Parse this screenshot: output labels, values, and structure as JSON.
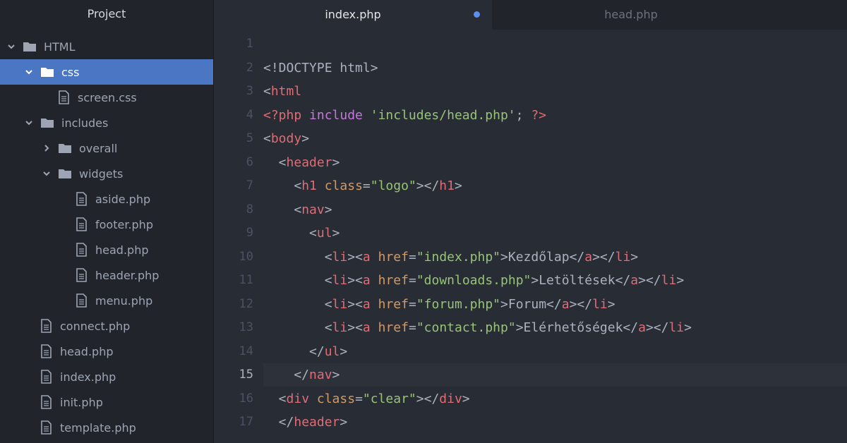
{
  "sidebar": {
    "title": "Project",
    "items": [
      {
        "label": "HTML",
        "type": "folder",
        "depth": 0,
        "expanded": true
      },
      {
        "label": "css",
        "type": "folder",
        "depth": 1,
        "expanded": true,
        "selected": true
      },
      {
        "label": "screen.css",
        "type": "file",
        "depth": 2
      },
      {
        "label": "includes",
        "type": "folder",
        "depth": 1,
        "expanded": true
      },
      {
        "label": "overall",
        "type": "folder",
        "depth": 2,
        "expanded": false
      },
      {
        "label": "widgets",
        "type": "folder",
        "depth": 2,
        "expanded": true
      },
      {
        "label": "aside.php",
        "type": "file",
        "depth": 3
      },
      {
        "label": "footer.php",
        "type": "file",
        "depth": 3
      },
      {
        "label": "head.php",
        "type": "file",
        "depth": 3
      },
      {
        "label": "header.php",
        "type": "file",
        "depth": 3
      },
      {
        "label": "menu.php",
        "type": "file",
        "depth": 3
      },
      {
        "label": "connect.php",
        "type": "file",
        "depth": 1
      },
      {
        "label": "head.php",
        "type": "file",
        "depth": 1
      },
      {
        "label": "index.php",
        "type": "file",
        "depth": 1
      },
      {
        "label": "init.php",
        "type": "file",
        "depth": 1
      },
      {
        "label": "template.php",
        "type": "file",
        "depth": 1
      }
    ]
  },
  "tabs": [
    {
      "label": "index.php",
      "active": true,
      "modified": true
    },
    {
      "label": "head.php",
      "active": false
    }
  ],
  "editor": {
    "active_line": 15,
    "lines": [
      {
        "n": "1",
        "tokens": []
      },
      {
        "n": "2",
        "tokens": [
          [
            "p",
            "<!DOCTYPE html>"
          ]
        ]
      },
      {
        "n": "3",
        "tokens": [
          [
            "p",
            "<"
          ],
          [
            "t",
            "html"
          ]
        ]
      },
      {
        "n": "4",
        "tokens": [
          [
            "t",
            "<?php"
          ],
          [
            "p",
            " "
          ],
          [
            "k",
            "include"
          ],
          [
            "p",
            " "
          ],
          [
            "s",
            "'includes/head.php'"
          ],
          [
            "p",
            "; "
          ],
          [
            "t",
            "?>"
          ]
        ]
      },
      {
        "n": "5",
        "tokens": [
          [
            "p",
            "<"
          ],
          [
            "t",
            "body"
          ],
          [
            "p",
            ">"
          ]
        ]
      },
      {
        "n": "6",
        "tokens": [
          [
            "p",
            "  <"
          ],
          [
            "t",
            "header"
          ],
          [
            "p",
            ">"
          ]
        ]
      },
      {
        "n": "7",
        "tokens": [
          [
            "p",
            "    <"
          ],
          [
            "t",
            "h1"
          ],
          [
            "p",
            " "
          ],
          [
            "a",
            "class"
          ],
          [
            "p",
            "="
          ],
          [
            "s",
            "\"logo\""
          ],
          [
            "p",
            "></"
          ],
          [
            "t",
            "h1"
          ],
          [
            "p",
            ">"
          ]
        ]
      },
      {
        "n": "8",
        "tokens": [
          [
            "p",
            "    <"
          ],
          [
            "t",
            "nav"
          ],
          [
            "p",
            ">"
          ]
        ]
      },
      {
        "n": "9",
        "tokens": [
          [
            "p",
            "      <"
          ],
          [
            "t",
            "ul"
          ],
          [
            "p",
            ">"
          ]
        ]
      },
      {
        "n": "10",
        "tokens": [
          [
            "p",
            "        <"
          ],
          [
            "t",
            "li"
          ],
          [
            "p",
            "><"
          ],
          [
            "t",
            "a"
          ],
          [
            "p",
            " "
          ],
          [
            "a",
            "href"
          ],
          [
            "p",
            "="
          ],
          [
            "s",
            "\"index.php\""
          ],
          [
            "p",
            ">Kezdőlap</"
          ],
          [
            "t",
            "a"
          ],
          [
            "p",
            "></"
          ],
          [
            "t",
            "li"
          ],
          [
            "p",
            ">"
          ]
        ]
      },
      {
        "n": "11",
        "tokens": [
          [
            "p",
            "        <"
          ],
          [
            "t",
            "li"
          ],
          [
            "p",
            "><"
          ],
          [
            "t",
            "a"
          ],
          [
            "p",
            " "
          ],
          [
            "a",
            "href"
          ],
          [
            "p",
            "="
          ],
          [
            "s",
            "\"downloads.php\""
          ],
          [
            "p",
            ">Letöltések</"
          ],
          [
            "t",
            "a"
          ],
          [
            "p",
            "></"
          ],
          [
            "t",
            "li"
          ],
          [
            "p",
            ">"
          ]
        ]
      },
      {
        "n": "12",
        "tokens": [
          [
            "p",
            "        <"
          ],
          [
            "t",
            "li"
          ],
          [
            "p",
            "><"
          ],
          [
            "t",
            "a"
          ],
          [
            "p",
            " "
          ],
          [
            "a",
            "href"
          ],
          [
            "p",
            "="
          ],
          [
            "s",
            "\"forum.php\""
          ],
          [
            "p",
            ">Forum</"
          ],
          [
            "t",
            "a"
          ],
          [
            "p",
            "></"
          ],
          [
            "t",
            "li"
          ],
          [
            "p",
            ">"
          ]
        ]
      },
      {
        "n": "13",
        "tokens": [
          [
            "p",
            "        <"
          ],
          [
            "t",
            "li"
          ],
          [
            "p",
            "><"
          ],
          [
            "t",
            "a"
          ],
          [
            "p",
            " "
          ],
          [
            "a",
            "href"
          ],
          [
            "p",
            "="
          ],
          [
            "s",
            "\"contact.php\""
          ],
          [
            "p",
            ">Elérhetőségek</"
          ],
          [
            "t",
            "a"
          ],
          [
            "p",
            "></"
          ],
          [
            "t",
            "li"
          ],
          [
            "p",
            ">"
          ]
        ]
      },
      {
        "n": "14",
        "tokens": [
          [
            "p",
            "      </"
          ],
          [
            "t",
            "ul"
          ],
          [
            "p",
            ">"
          ]
        ]
      },
      {
        "n": "15",
        "tokens": [
          [
            "p",
            "    </"
          ],
          [
            "t",
            "nav"
          ],
          [
            "p",
            ">"
          ]
        ]
      },
      {
        "n": "16",
        "tokens": [
          [
            "p",
            "  <"
          ],
          [
            "t",
            "div"
          ],
          [
            "p",
            " "
          ],
          [
            "a",
            "class"
          ],
          [
            "p",
            "="
          ],
          [
            "s",
            "\"clear\""
          ],
          [
            "p",
            "></"
          ],
          [
            "t",
            "div"
          ],
          [
            "p",
            ">"
          ]
        ]
      },
      {
        "n": "17",
        "tokens": [
          [
            "p",
            "  </"
          ],
          [
            "t",
            "header"
          ],
          [
            "p",
            ">"
          ]
        ]
      }
    ]
  },
  "colors": {
    "selection": "#4a76c4",
    "tag": "#e06c75",
    "attr": "#d19a66",
    "string": "#98c379",
    "keyword": "#c678dd",
    "modified_dot": "#5c8ef0"
  }
}
